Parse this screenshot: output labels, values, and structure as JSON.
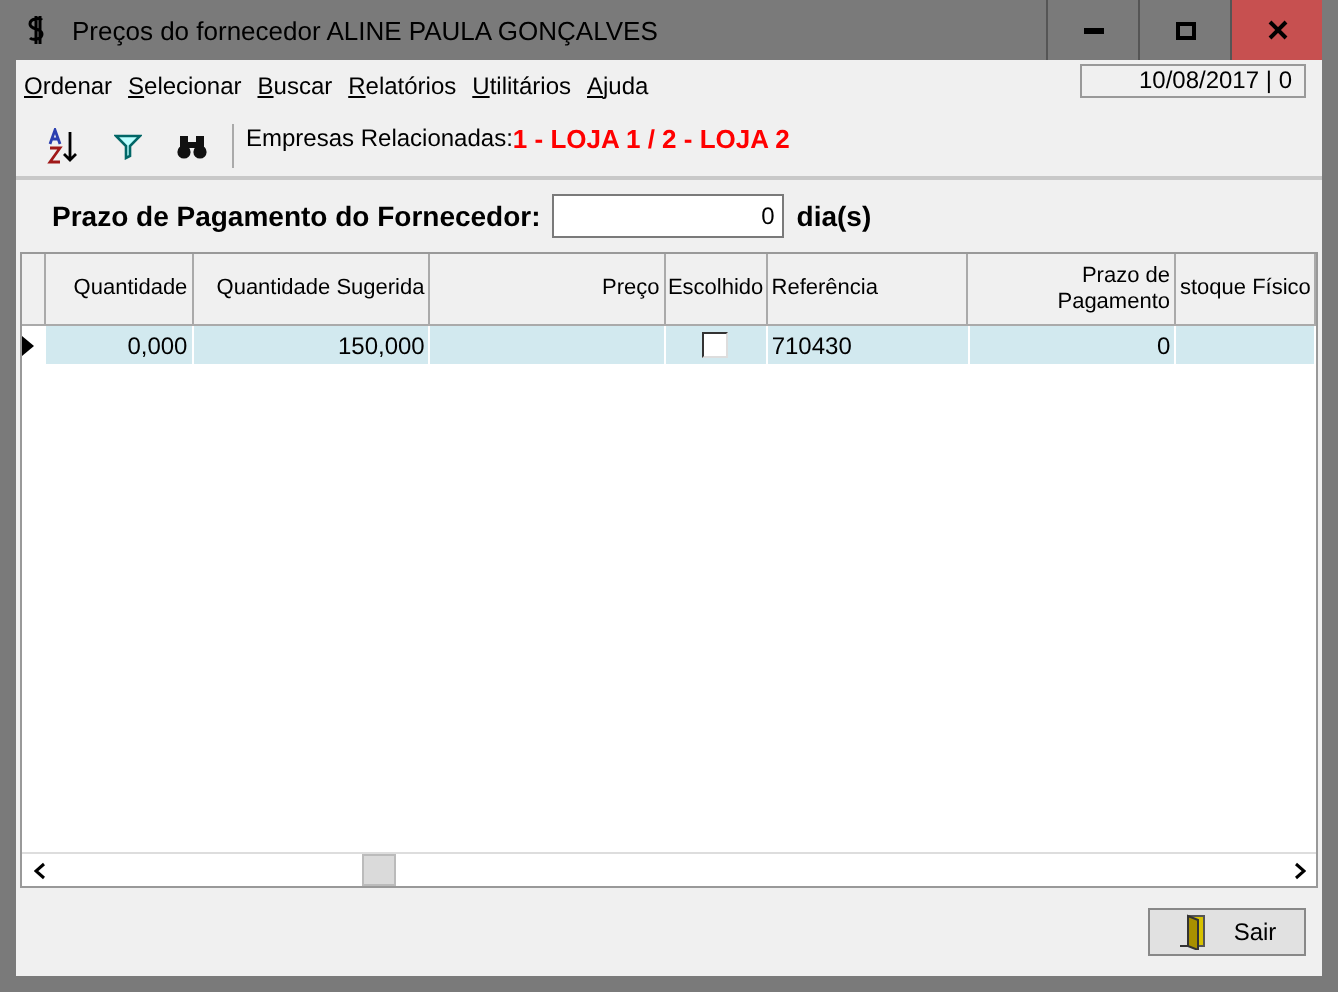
{
  "window": {
    "title": "Preços do fornecedor ALINE PAULA GONÇALVES"
  },
  "menu": [
    "Ordenar",
    "Selecionar",
    "Buscar",
    "Relatórios",
    "Utilitários",
    "Ajuda"
  ],
  "date_field": "10/08/2017 | 0",
  "toolbar": {
    "label": "Empresas Relacionadas:",
    "companies": "1 - LOJA 1 / 2 - LOJA 2"
  },
  "payment_term": {
    "label": "Prazo de Pagamento do Fornecedor:",
    "value": "0",
    "unit": "dia(s)"
  },
  "table": {
    "columns": [
      "Quantidade",
      "Quantidade Sugerida",
      "Preço",
      "Escolhido",
      "Referência",
      "Prazo de Pagamento",
      "stoque Físico"
    ],
    "rows": [
      {
        "selected": true,
        "cells": [
          "0,000",
          "150,000",
          "",
          {
            "kind": "checkbox",
            "checked": false
          },
          "710430",
          "0",
          ""
        ]
      }
    ]
  },
  "buttons": [
    {
      "label": "Sair"
    }
  ]
}
